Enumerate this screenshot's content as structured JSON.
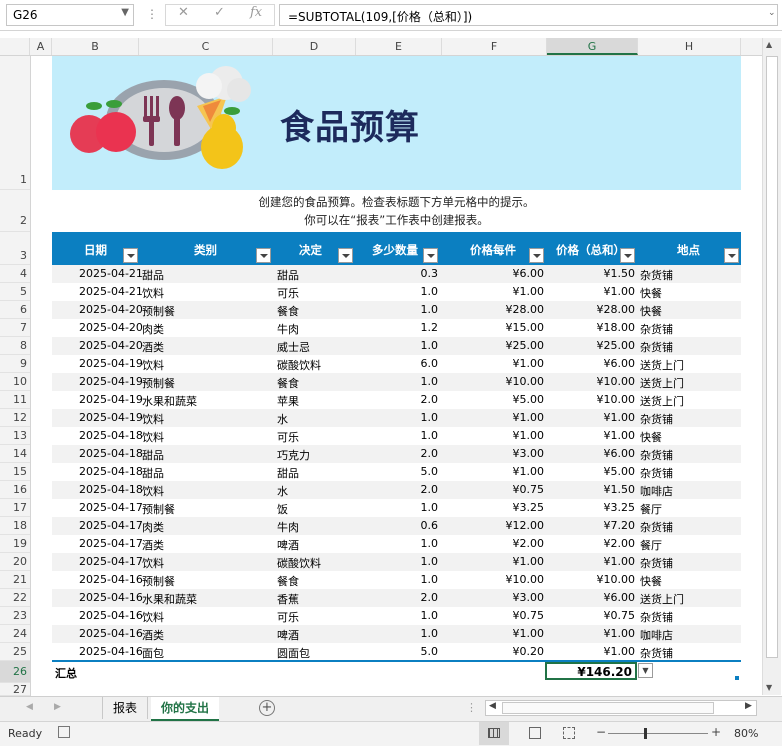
{
  "formula_bar": {
    "name_box": "G26",
    "formula": "=SUBTOTAL(109,[价格（总和）])",
    "cancel_icon": "✕",
    "enter_icon": "✓",
    "fx_label": "fx"
  },
  "columns": [
    "A",
    "B",
    "C",
    "D",
    "E",
    "F",
    "G",
    "H"
  ],
  "rows": [
    "1",
    "2",
    "3",
    "4",
    "5",
    "6",
    "7",
    "8",
    "9",
    "10",
    "11",
    "12",
    "13",
    "14",
    "15",
    "16",
    "17",
    "18",
    "19",
    "20",
    "21",
    "22",
    "23",
    "24",
    "25",
    "26",
    "27"
  ],
  "banner": {
    "title": "食品预算"
  },
  "instructions": [
    "创建您的食品预算。检查表标题下方单元格中的提示。",
    "你可以在“报表”工作表中创建报表。"
  ],
  "table": {
    "headers": [
      "日期",
      "类别",
      "决定",
      "多少数量",
      "价格每件",
      "价格（总和）",
      "地点"
    ],
    "rows": [
      [
        "2025-04-21",
        "甜品",
        "甜品",
        "0.3",
        "¥6.00",
        "¥1.50",
        "杂货铺"
      ],
      [
        "2025-04-21",
        "饮料",
        "可乐",
        "1.0",
        "¥1.00",
        "¥1.00",
        "快餐"
      ],
      [
        "2025-04-20",
        "预制餐",
        "餐食",
        "1.0",
        "¥28.00",
        "¥28.00",
        "快餐"
      ],
      [
        "2025-04-20",
        "肉类",
        "牛肉",
        "1.2",
        "¥15.00",
        "¥18.00",
        "杂货铺"
      ],
      [
        "2025-04-20",
        "酒类",
        "威士忌",
        "1.0",
        "¥25.00",
        "¥25.00",
        "杂货铺"
      ],
      [
        "2025-04-19",
        "饮料",
        "碳酸饮料",
        "6.0",
        "¥1.00",
        "¥6.00",
        "送货上门"
      ],
      [
        "2025-04-19",
        "预制餐",
        "餐食",
        "1.0",
        "¥10.00",
        "¥10.00",
        "送货上门"
      ],
      [
        "2025-04-19",
        "水果和蔬菜",
        "苹果",
        "2.0",
        "¥5.00",
        "¥10.00",
        "送货上门"
      ],
      [
        "2025-04-19",
        "饮料",
        "水",
        "1.0",
        "¥1.00",
        "¥1.00",
        "杂货铺"
      ],
      [
        "2025-04-18",
        "饮料",
        "可乐",
        "1.0",
        "¥1.00",
        "¥1.00",
        "快餐"
      ],
      [
        "2025-04-18",
        "甜品",
        "巧克力",
        "2.0",
        "¥3.00",
        "¥6.00",
        "杂货铺"
      ],
      [
        "2025-04-18",
        "甜品",
        "甜品",
        "5.0",
        "¥1.00",
        "¥5.00",
        "杂货铺"
      ],
      [
        "2025-04-18",
        "饮料",
        "水",
        "2.0",
        "¥0.75",
        "¥1.50",
        "咖啡店"
      ],
      [
        "2025-04-17",
        "预制餐",
        "饭",
        "1.0",
        "¥3.25",
        "¥3.25",
        "餐厅"
      ],
      [
        "2025-04-17",
        "肉类",
        "牛肉",
        "0.6",
        "¥12.00",
        "¥7.20",
        "杂货铺"
      ],
      [
        "2025-04-17",
        "酒类",
        "啤酒",
        "1.0",
        "¥2.00",
        "¥2.00",
        "餐厅"
      ],
      [
        "2025-04-17",
        "饮料",
        "碳酸饮料",
        "1.0",
        "¥1.00",
        "¥1.00",
        "杂货铺"
      ],
      [
        "2025-04-16",
        "预制餐",
        "餐食",
        "1.0",
        "¥10.00",
        "¥10.00",
        "快餐"
      ],
      [
        "2025-04-16",
        "水果和蔬菜",
        "香蕉",
        "2.0",
        "¥3.00",
        "¥6.00",
        "送货上门"
      ],
      [
        "2025-04-16",
        "饮料",
        "可乐",
        "1.0",
        "¥0.75",
        "¥0.75",
        "杂货铺"
      ],
      [
        "2025-04-16",
        "酒类",
        "啤酒",
        "1.0",
        "¥1.00",
        "¥1.00",
        "咖啡店"
      ],
      [
        "2025-04-16",
        "面包",
        "圆面包",
        "5.0",
        "¥0.20",
        "¥1.00",
        "杂货铺"
      ]
    ],
    "total_label": "汇总",
    "total_value": "¥146.20"
  },
  "sheet_tabs": [
    "报表",
    "你的支出"
  ],
  "active_tab": "你的支出",
  "status": {
    "ready": "Ready",
    "zoom": "80%"
  },
  "colors": {
    "accent_green": "#217346",
    "table_header": "#0b7fc1",
    "banner_bg": "#c2edfb",
    "title_color": "#1d2a5c"
  }
}
